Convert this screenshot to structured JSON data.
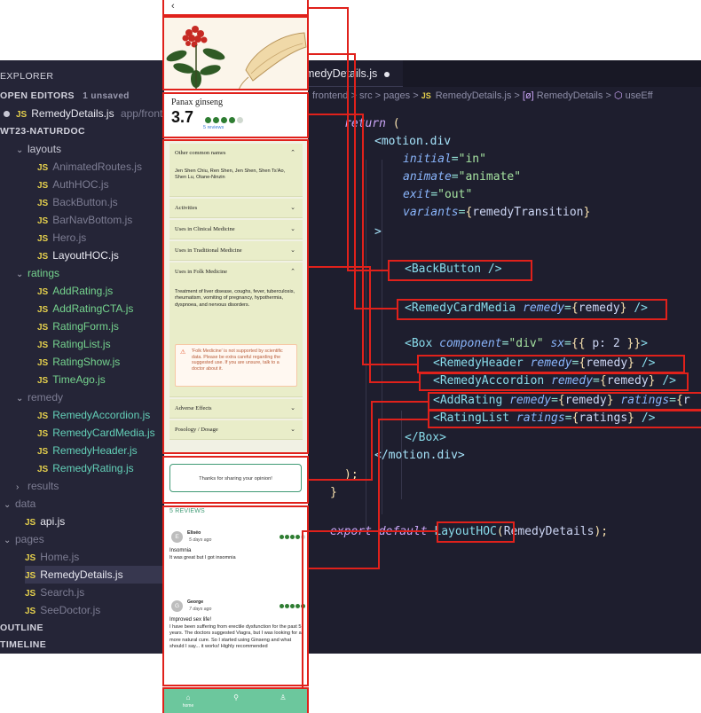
{
  "explorer": {
    "title": "EXPLORER",
    "open_editors": "OPEN EDITORS",
    "unsaved_badge": "1 unsaved",
    "open_file": "RemedyDetails.js",
    "open_file_path": "app/front",
    "project": "WT23-NATURDOC",
    "tree": [
      {
        "kind": "folder",
        "label": "layouts",
        "indent": 1
      },
      {
        "kind": "file",
        "label": "AnimatedRoutes.js",
        "indent": 2,
        "tone": "dim"
      },
      {
        "kind": "file",
        "label": "AuthHOC.js",
        "indent": 2,
        "tone": "dim"
      },
      {
        "kind": "file",
        "label": "BackButton.js",
        "indent": 2,
        "tone": "dim"
      },
      {
        "kind": "file",
        "label": "BarNavBottom.js",
        "indent": 2,
        "tone": "dim"
      },
      {
        "kind": "file",
        "label": "Hero.js",
        "indent": 2,
        "tone": "dim"
      },
      {
        "kind": "file",
        "label": "LayoutHOC.js",
        "indent": 2,
        "tone": "white"
      },
      {
        "kind": "folder",
        "label": "ratings",
        "indent": 1,
        "tone": "green"
      },
      {
        "kind": "file",
        "label": "AddRating.js",
        "indent": 2,
        "tone": "green"
      },
      {
        "kind": "file",
        "label": "AddRatingCTA.js",
        "indent": 2,
        "tone": "green"
      },
      {
        "kind": "file",
        "label": "RatingForm.js",
        "indent": 2,
        "tone": "green"
      },
      {
        "kind": "file",
        "label": "RatingList.js",
        "indent": 2,
        "tone": "green"
      },
      {
        "kind": "file",
        "label": "RatingShow.js",
        "indent": 2,
        "tone": "green"
      },
      {
        "kind": "file",
        "label": "TimeAgo.js",
        "indent": 2,
        "tone": "green"
      },
      {
        "kind": "folder",
        "label": "remedy",
        "indent": 1,
        "tone": "dim"
      },
      {
        "kind": "file",
        "label": "RemedyAccordion.js",
        "indent": 2,
        "tone": "teal"
      },
      {
        "kind": "file",
        "label": "RemedyCardMedia.js",
        "indent": 2,
        "tone": "teal"
      },
      {
        "kind": "file",
        "label": "RemedyHeader.js",
        "indent": 2,
        "tone": "teal"
      },
      {
        "kind": "file",
        "label": "RemedyRating.js",
        "indent": 2,
        "tone": "teal"
      },
      {
        "kind": "folder-closed",
        "label": "results",
        "indent": 1,
        "tone": "dim"
      },
      {
        "kind": "folder",
        "label": "data",
        "indent": 0,
        "tone": "dim"
      },
      {
        "kind": "file",
        "label": "api.js",
        "indent": 1,
        "tone": "white"
      },
      {
        "kind": "folder",
        "label": "pages",
        "indent": 0,
        "tone": "dim"
      },
      {
        "kind": "file",
        "label": "Home.js",
        "indent": 1,
        "tone": "dim"
      },
      {
        "kind": "file",
        "label": "RemedyDetails.js",
        "indent": 1,
        "tone": "white",
        "selected": true
      },
      {
        "kind": "file",
        "label": "Search.js",
        "indent": 1,
        "tone": "dim"
      },
      {
        "kind": "file",
        "label": "SeeDoctor.js",
        "indent": 1,
        "tone": "dim"
      }
    ],
    "outline": "OUTLINE",
    "timeline": "TIMELINE"
  },
  "editor": {
    "tab_label": "medyDetails.js",
    "breadcrumb": {
      "c1": "frontend",
      "c2": "src",
      "c3": "pages",
      "c4": "RemedyDetails.js",
      "c5": "RemedyDetails",
      "c6": "useEff",
      "sep": ">",
      "js": "JS"
    }
  },
  "code": {
    "l_return": "return",
    "l_paren": " (",
    "l_motion_open": "<motion.div",
    "l_initial_attr": "initial",
    "l_initial_val": "\"in\"",
    "l_animate_attr": "animate",
    "l_animate_val": "\"animate\"",
    "l_exit_attr": "exit",
    "l_exit_val": "\"out\"",
    "l_variants_attr": "variants",
    "l_variants_val": "remedyTransition",
    "l_gt": ">",
    "l_backbutton": "<BackButton />",
    "l_cardmedia_tag": "<RemedyCardMedia",
    "l_cardmedia_attr": "remedy",
    "l_cardmedia_val": "remedy",
    "l_box_tag": "<Box",
    "l_box_attr": "component",
    "l_box_val": "\"div\"",
    "l_box_sx": "sx",
    "l_box_sxval": "p: 2",
    "l_header_tag": "<RemedyHeader",
    "l_header_attr": "remedy",
    "l_header_val": "remedy",
    "l_accordion_tag": "<RemedyAccordion",
    "l_accordion_attr": "remedy",
    "l_accordion_val": "remedy",
    "l_addrating_tag": "<AddRating",
    "l_addrating_attr": "remedy",
    "l_addrating_val": "remedy",
    "l_addrating_attr2": "ratings",
    "l_addrating_val2": "r",
    "l_ratinglist_tag": "<RatingList",
    "l_ratinglist_attr": "ratings",
    "l_ratinglist_val": "ratings",
    "l_box_close": "</Box>",
    "l_motion_close": "</motion.div>",
    "l_close_paren": ");",
    "l_close_brace": "}",
    "l_export": "export default",
    "l_layouthoc": "LayoutHOC",
    "l_export_arg": "RemedyDetails",
    "l_export_end": ");"
  },
  "phone": {
    "remedy_name": "Panax ginseng",
    "rating_value": "3.7",
    "rating_fraction": 0.74,
    "reviews_count": "5 reviews",
    "accordion": [
      {
        "title": "Other common names",
        "expanded": true,
        "body": "Jen Shen Chiu, Ren Shen, Jen Shen, Shen Ts'Ao, Shen Lu, Otane-Ninzin"
      },
      {
        "title": "Activities",
        "expanded": false
      },
      {
        "title": "Uses in Clinical Medicine",
        "expanded": false
      },
      {
        "title": "Uses in Traditional Medicine",
        "expanded": false
      },
      {
        "title": "Uses in Folk Medicine",
        "expanded": true,
        "body": "Treatment of liver disease, coughs, fever, tuberculosis, rheumatism, vomiting of pregnancy, hypothermia, dyspnoea, and nervous disorders.",
        "warning": "'Folk Medicine' is not supported by scientific data. Please be extra careful regarding the suggested use. If you are unsure, talk to a doctor about it."
      },
      {
        "title": "Adverse Effects",
        "expanded": false
      },
      {
        "title": "Posology / Dosage",
        "expanded": false
      }
    ],
    "cta_text": "Thanks for sharing your opinion!",
    "reviews_heading": "5 REVIEWS",
    "reviews": [
      {
        "initial": "E",
        "author": "Eliséo",
        "time": "5 days ago",
        "rating": 4,
        "title": "Insomnia",
        "body": "It was great but I got insomnia"
      },
      {
        "initial": "G",
        "author": "George",
        "time": "7 days ago",
        "rating": 5,
        "title": "Improved sex life!",
        "body": "I have been suffering from erectile dysfunction for the past 5 years. The doctors suggested Viagra, but I was looking for a more natural cure. So I started using Ginseng and what should I say... it works! Highly recommended"
      }
    ],
    "nav": {
      "home_label": "home",
      "home_icon": "home-icon",
      "search_icon": "search-icon",
      "account_icon": "account-icon"
    }
  },
  "colors": {
    "annotation_red": "#e0211b",
    "editor_bg": "#1e1e2e",
    "sidebar_bg": "#252537",
    "nav_green": "#6cc79d",
    "accordion_bg": "#e9edc9"
  }
}
